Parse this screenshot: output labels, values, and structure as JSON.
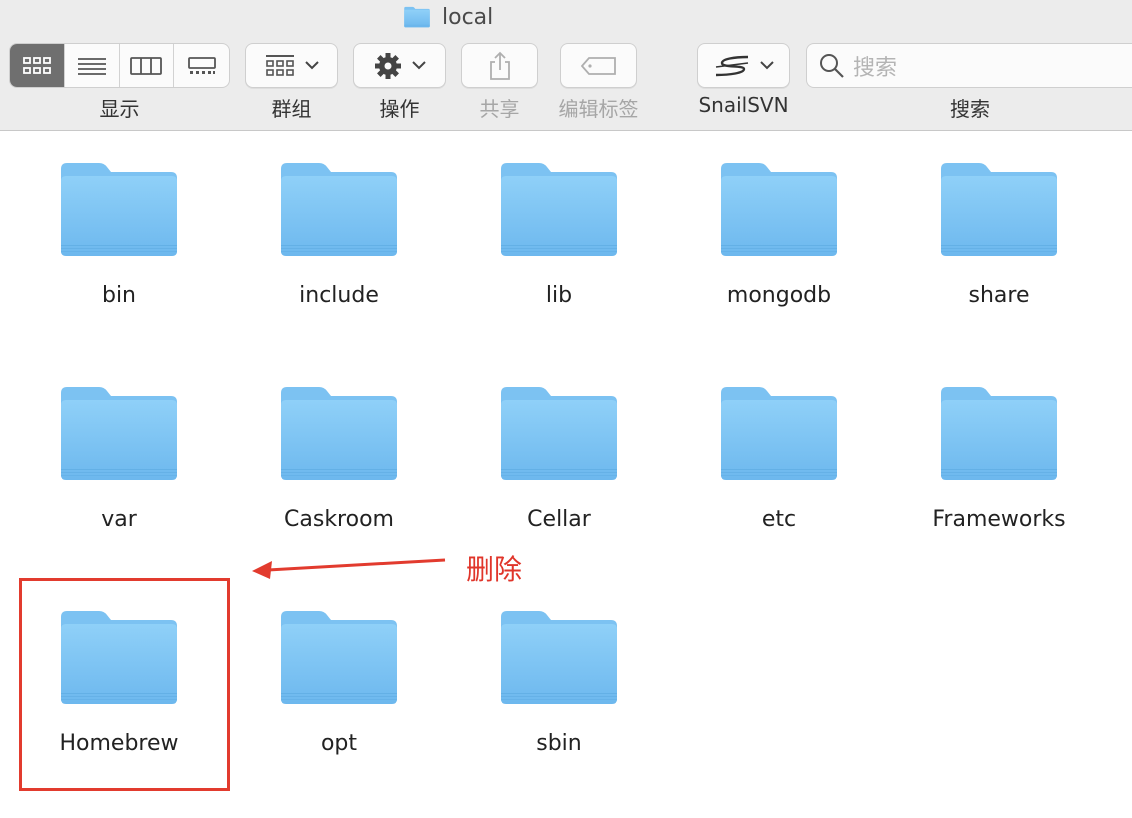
{
  "window": {
    "title": "local"
  },
  "toolbar": {
    "view_label": "显示",
    "group_label": "群组",
    "action_label": "操作",
    "share_label": "共享",
    "tags_label": "编辑标签",
    "svn_label": "SnailSVN",
    "search_label": "搜索",
    "search_placeholder": "搜索",
    "active_view": "icon-view"
  },
  "files": [
    {
      "name": "bin"
    },
    {
      "name": "include"
    },
    {
      "name": "lib"
    },
    {
      "name": "mongodb"
    },
    {
      "name": "share"
    },
    {
      "name": "var"
    },
    {
      "name": "Caskroom"
    },
    {
      "name": "Cellar"
    },
    {
      "name": "etc"
    },
    {
      "name": "Frameworks"
    },
    {
      "name": "Homebrew"
    },
    {
      "name": "opt"
    },
    {
      "name": "sbin"
    }
  ],
  "annotation": {
    "text": "删除",
    "color": "#e0352a"
  },
  "colors": {
    "folder_top": "#8ccbf5",
    "folder_body": "#74bdf0",
    "toolbar_bg": "#ececec"
  }
}
